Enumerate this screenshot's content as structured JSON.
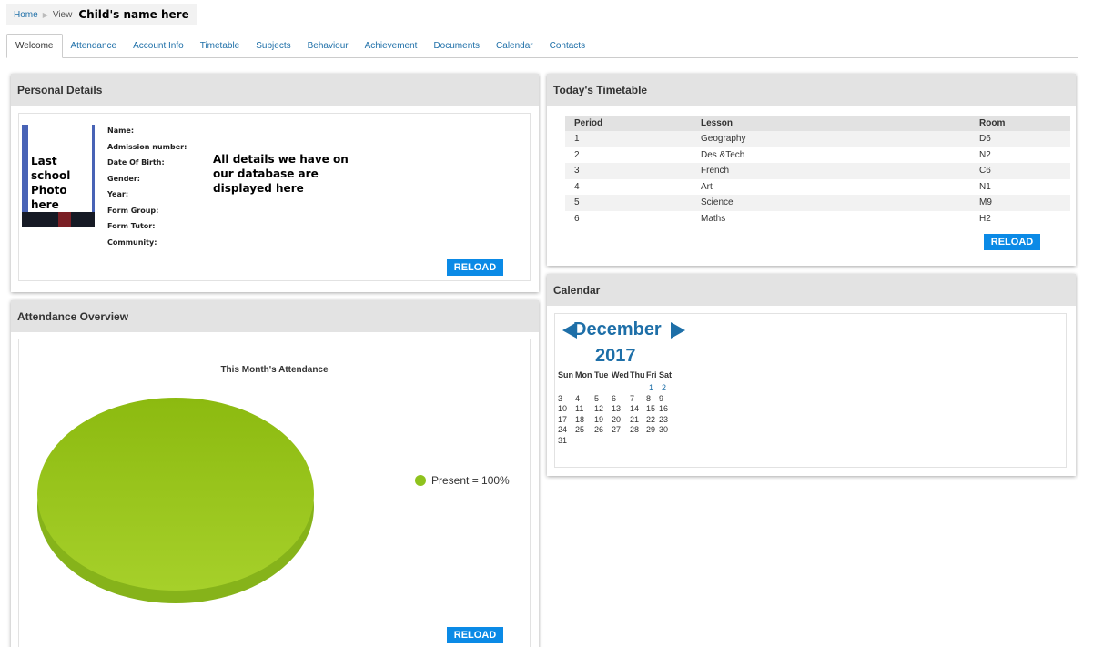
{
  "breadcrumb": {
    "home": "Home",
    "view": "View",
    "child_name": "Child's name here"
  },
  "tabs": [
    "Welcome",
    "Attendance",
    "Account Info",
    "Timetable",
    "Subjects",
    "Behaviour",
    "Achievement",
    "Documents",
    "Calendar",
    "Contacts"
  ],
  "personal": {
    "title": "Personal Details",
    "photo_text": "Last school Photo here",
    "fields": [
      "Name:",
      "Admission number:",
      "Date Of Birth:",
      "Gender:",
      "Year:",
      "Form Group:",
      "Form Tutor:",
      "Community:"
    ],
    "note": "All details we have on our database are displayed here",
    "reload": "RELOAD"
  },
  "attendance": {
    "title": "Attendance Overview",
    "reload": "RELOAD",
    "legend_color": "#8ec21d"
  },
  "chart_data": {
    "type": "pie",
    "title": "This Month's Attendance",
    "series": [
      {
        "label": "Present = 100%",
        "value": 100,
        "color": "#8ec21d"
      }
    ]
  },
  "timetable": {
    "title": "Today's Timetable",
    "headers": [
      "Period",
      "Lesson",
      "Room"
    ],
    "rows": [
      [
        "1",
        "Geography",
        "D6"
      ],
      [
        "2",
        "Des &Tech",
        "N2"
      ],
      [
        "3",
        "French",
        "C6"
      ],
      [
        "4",
        "Art",
        "N1"
      ],
      [
        "5",
        "Science",
        "M9"
      ],
      [
        "6",
        "Maths",
        "H2"
      ]
    ],
    "reload": "RELOAD"
  },
  "calendar": {
    "title": "Calendar",
    "month": "December",
    "year": "2017",
    "weekdays": [
      "Sun",
      "Mon",
      "Tue",
      "Wed",
      "Thu",
      "Fri",
      "Sat"
    ],
    "weeks": [
      [
        "",
        "",
        "",
        "",
        "",
        "1",
        "2"
      ],
      [
        "3",
        "4",
        "5",
        "6",
        "7",
        "8",
        "9"
      ],
      [
        "10",
        "11",
        "12",
        "13",
        "14",
        "15",
        "16"
      ],
      [
        "17",
        "18",
        "19",
        "20",
        "21",
        "22",
        "23"
      ],
      [
        "24",
        "25",
        "26",
        "27",
        "28",
        "29",
        "30"
      ],
      [
        "31",
        "",
        "",
        "",
        "",
        "",
        ""
      ]
    ]
  }
}
